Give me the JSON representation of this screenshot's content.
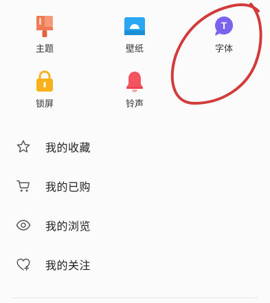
{
  "grid": {
    "items": [
      {
        "label": "主题",
        "icon": "paint-brush-icon"
      },
      {
        "label": "壁纸",
        "icon": "wallpaper-icon"
      },
      {
        "label": "字体",
        "icon": "font-icon",
        "icon_letter": "T"
      },
      {
        "label": "锁屏",
        "icon": "lock-icon"
      },
      {
        "label": "铃声",
        "icon": "bell-icon"
      }
    ]
  },
  "list": {
    "items": [
      {
        "label": "我的收藏",
        "icon": "star-icon"
      },
      {
        "label": "我的已购",
        "icon": "cart-icon"
      },
      {
        "label": "我的浏览",
        "icon": "eye-icon"
      },
      {
        "label": "我的关注",
        "icon": "heart-icon"
      }
    ]
  },
  "colors": {
    "theme_icon": "#f07a54",
    "wallpaper_icon": "#2aa7f2",
    "font_icon": "#7b63f0",
    "lock_icon": "#f7b21b",
    "bell_icon": "#f25560",
    "annotation": "#d33b3b"
  }
}
